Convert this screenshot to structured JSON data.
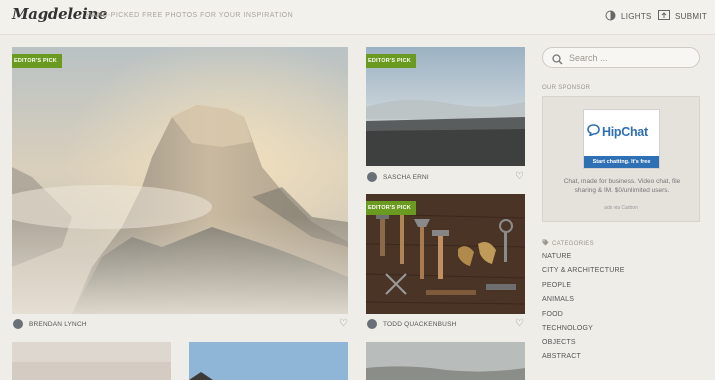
{
  "header": {
    "logo": "Magdeleine",
    "tagline": "HAND-PICKED FREE PHOTOS FOR YOUR INSPIRATION",
    "lights_label": "LIGHTS",
    "submit_label": "SUBMIT"
  },
  "photos": [
    {
      "badge": "EDITOR'S PICK",
      "author": "BRENDAN LYNCH"
    },
    {
      "badge": "EDITOR'S PICK",
      "author": "SASCHA ERNI"
    },
    {
      "badge": "EDITOR'S PICK",
      "author": "TODD QUACKENBUSH"
    }
  ],
  "sidebar": {
    "search_placeholder": "Search ...",
    "sponsor_heading": "OUR SPONSOR",
    "ad": {
      "brand": "HipChat",
      "cta": "Start chatting. It's free",
      "text": "Chat, made for business. Video chat, file sharing & IM. $0/unlimited users.",
      "via": "ads via Carbon"
    },
    "categories_heading": "CATEGORIES",
    "categories": [
      "NATURE",
      "CITY & ARCHITECTURE",
      "PEOPLE",
      "ANIMALS",
      "FOOD",
      "TECHNOLOGY",
      "OBJECTS",
      "ABSTRACT"
    ]
  },
  "icons": {
    "lights": "lightbulb-icon",
    "submit": "upload-icon",
    "search": "search-icon",
    "like": "heart-icon",
    "categories": "tag-icon"
  },
  "colors": {
    "badge": "#6a9a1f",
    "hipchat_blue": "#2f6fb3",
    "page_bg": "#efede8"
  }
}
